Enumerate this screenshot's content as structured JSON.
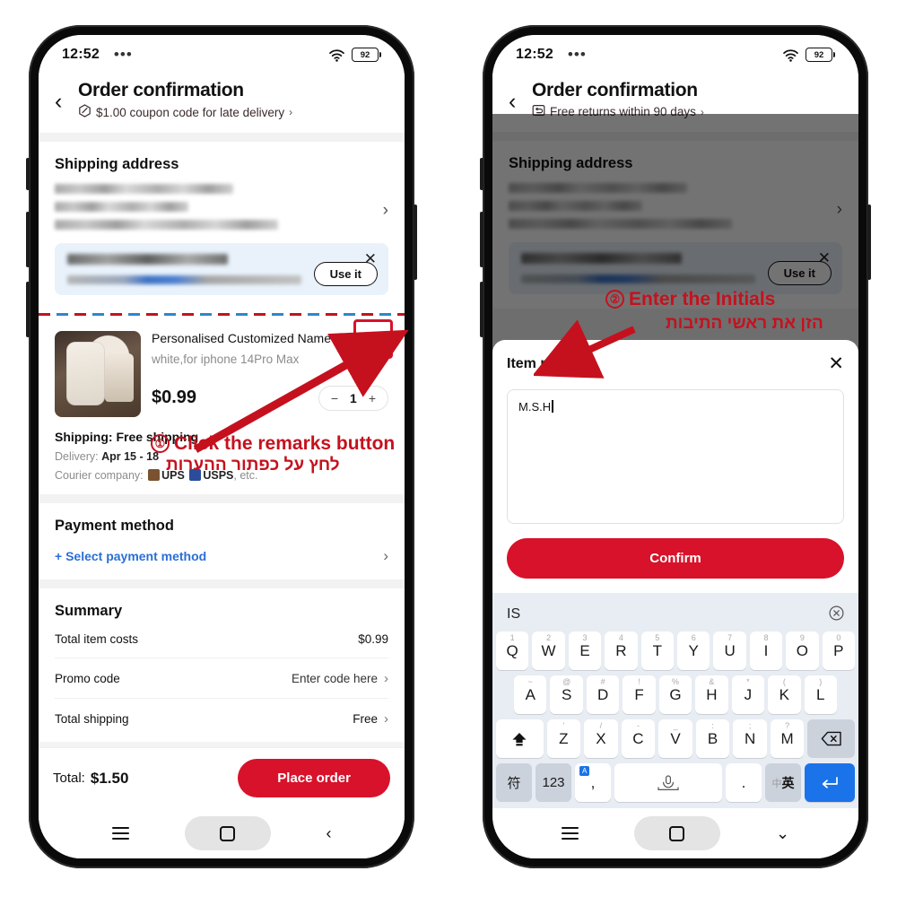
{
  "meta": {
    "accent_red": "#d8122a",
    "annotation_red": "#c5111e",
    "link_blue": "#2a6fd6",
    "keyboard_blue": "#1a73e8"
  },
  "status_bar": {
    "time": "12:52",
    "dots": "•••",
    "wifi_icon": "wifi-icon",
    "battery_level": "92"
  },
  "left_phone": {
    "appbar": {
      "back_icon": "chevron-left-icon",
      "title": "Order confirmation",
      "coupon_icon": "coupon-icon",
      "coupon_text": "$1.00 coupon code for late delivery",
      "coupon_chevron": "›"
    },
    "shipping": {
      "section_title": "Shipping address",
      "address_redacted": true,
      "chevron": "›",
      "suggestion": {
        "title_redacted": true,
        "body_redacted": true,
        "close_icon": "close-icon",
        "use_it_label": "Use it"
      }
    },
    "product": {
      "edit_icon": "pencil-edit-icon",
      "name": "Personalised Customized Name Case For Iphone 15...",
      "variant": "white,for iphone 14Pro Max",
      "price": "$0.99",
      "qty_minus": "−",
      "qty_value": "1",
      "qty_plus": "+",
      "shipping_label": "Shipping:",
      "shipping_value": "Free shipping",
      "delivery_label": "Delivery:",
      "delivery_value": "Apr 15 - 18",
      "courier_label": "Courier company:",
      "courier_ups": "UPS",
      "courier_usps": "USPS",
      "courier_suffix": ", etc."
    },
    "payment": {
      "section_title": "Payment method",
      "select_label": "+ Select payment method",
      "chevron": "›"
    },
    "summary": {
      "section_title": "Summary",
      "rows": [
        {
          "label": "Total item costs",
          "value": "$0.99",
          "chevron": ""
        },
        {
          "label": "Promo code",
          "value": "Enter code here",
          "chevron": "›"
        },
        {
          "label": "Total shipping",
          "value": "Free",
          "chevron": "›"
        }
      ]
    },
    "bottom_bar": {
      "total_label": "Total:",
      "total_value": "$1.50",
      "place_order_label": "Place order"
    },
    "nav": {
      "menu_icon": "menu-icon",
      "home_icon": "home-square-icon",
      "back_icon": "chevron-left-icon"
    }
  },
  "right_phone": {
    "appbar": {
      "back_icon": "chevron-left-icon",
      "title": "Order confirmation",
      "returns_icon": "returns-box-icon",
      "returns_text": "Free returns within 90 days",
      "returns_chevron": "›"
    },
    "shipping": {
      "section_title": "Shipping address",
      "chevron": "›",
      "suggestion": {
        "close_icon": "close-icon",
        "use_it_label": "Use it"
      }
    },
    "modal": {
      "title": "Item remarks",
      "close_icon": "close-icon",
      "remark_value": "M.S.H",
      "confirm_label": "Confirm"
    },
    "keyboard": {
      "suggestion": "IS",
      "clear_icon": "clear-circle-icon",
      "row1": [
        {
          "key": "Q",
          "alt": "1"
        },
        {
          "key": "W",
          "alt": "2"
        },
        {
          "key": "E",
          "alt": "3"
        },
        {
          "key": "R",
          "alt": "4"
        },
        {
          "key": "T",
          "alt": "5"
        },
        {
          "key": "Y",
          "alt": "6"
        },
        {
          "key": "U",
          "alt": "7"
        },
        {
          "key": "I",
          "alt": "8"
        },
        {
          "key": "O",
          "alt": "9"
        },
        {
          "key": "P",
          "alt": "0"
        }
      ],
      "row2": [
        {
          "key": "A",
          "alt": "~"
        },
        {
          "key": "S",
          "alt": "@"
        },
        {
          "key": "D",
          "alt": "#"
        },
        {
          "key": "F",
          "alt": "!"
        },
        {
          "key": "G",
          "alt": "%"
        },
        {
          "key": "H",
          "alt": "&"
        },
        {
          "key": "J",
          "alt": "*"
        },
        {
          "key": "K",
          "alt": "("
        },
        {
          "key": "L",
          "alt": ")"
        }
      ],
      "row3": [
        {
          "key": "Z",
          "alt": "'"
        },
        {
          "key": "X",
          "alt": "/"
        },
        {
          "key": "C",
          "alt": "-"
        },
        {
          "key": "V",
          "alt": "_"
        },
        {
          "key": "B",
          "alt": ":"
        },
        {
          "key": "N",
          "alt": ";"
        },
        {
          "key": "M",
          "alt": "?"
        }
      ],
      "shift_icon": "shift-up-icon",
      "backspace_icon": "backspace-icon",
      "symbol_key": "符",
      "numeric_key": "123",
      "comma_key": ",",
      "comma_badge": "A",
      "space_icon": "microphone-icon",
      "period_key": ".",
      "lang_key_cn": "中",
      "lang_key_en": "英",
      "enter_icon": "enter-return-icon"
    },
    "nav": {
      "menu_icon": "menu-icon",
      "home_icon": "home-square-icon",
      "collapse_icon": "chevron-down-icon"
    }
  },
  "annotations": {
    "step1_number": "①",
    "step1_en": "Click the remarks button",
    "step1_he": "לחץ על כפתור ההערות",
    "step2_number": "②",
    "step2_en": "Enter the Initials",
    "step2_he": "הזן את ראשי התיבות"
  }
}
